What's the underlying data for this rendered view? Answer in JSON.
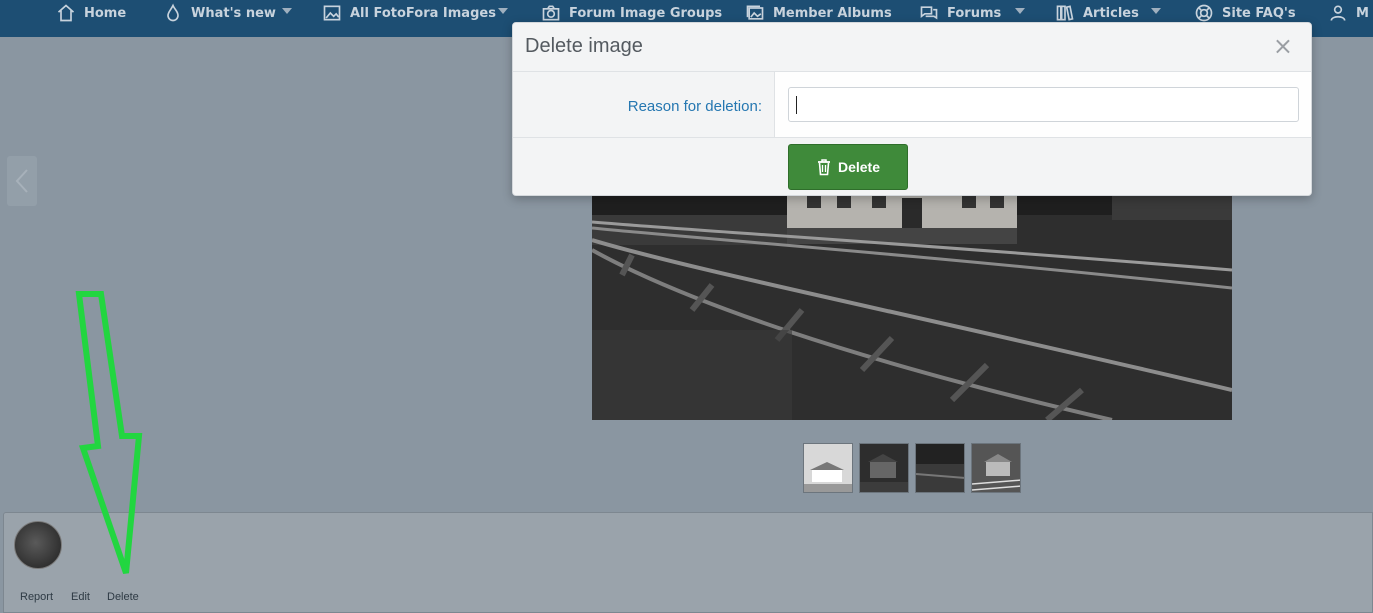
{
  "nav": {
    "items": [
      {
        "label": "Home",
        "icon": "home-icon"
      },
      {
        "label": "What's new",
        "icon": "flame-icon"
      },
      {
        "label": "All FotoFora Images",
        "icon": "image-icon"
      },
      {
        "label": "Forum Image Groups",
        "icon": "camera-icon"
      },
      {
        "label": "Member Albums",
        "icon": "images-icon"
      },
      {
        "label": "Forums",
        "icon": "comments-icon"
      },
      {
        "label": "Articles",
        "icon": "books-icon"
      },
      {
        "label": "Site FAQ's",
        "icon": "life-ring-icon"
      },
      {
        "label": "M",
        "icon": "user-icon"
      }
    ]
  },
  "modal": {
    "title": "Delete image",
    "close_symbol": "×",
    "reason_label": "Reason for deletion:",
    "reason_value": "",
    "delete_label": "Delete"
  },
  "media_actions": {
    "report": "Report",
    "edit": "Edit",
    "delete": "Delete"
  },
  "colors": {
    "nav_bg": "#1d4e73",
    "delete_button": "#3f8a3a",
    "label_blue": "#2577b1",
    "annotation_green": "#22d640"
  }
}
